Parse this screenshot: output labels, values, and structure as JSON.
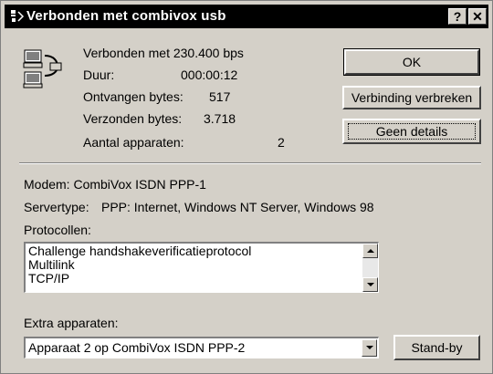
{
  "window": {
    "title": "Verbonden met combivox usb",
    "help_button": "?",
    "close_button": "✕"
  },
  "status": {
    "connected_at": "Verbonden met 230.400 bps",
    "duration_label": "Duur:",
    "duration_value": "000:00:12",
    "received_label": "Ontvangen bytes:",
    "received_value": "517",
    "sent_label": "Verzonden bytes:",
    "sent_value": "3.718",
    "devices_label": "Aantal apparaten:",
    "devices_value": "2"
  },
  "buttons": {
    "ok": "OK",
    "disconnect": "Verbinding verbreken",
    "less_details": "Geen details",
    "standby": "Stand-by"
  },
  "details": {
    "modem": "Modem: CombiVox ISDN PPP-1",
    "servertype_label": "Servertype:",
    "servertype_value": "PPP: Internet, Windows NT Server, Windows 98",
    "protocols_label": "Protocollen:",
    "protocols": [
      "Challenge handshakeverificatieprotocol",
      "Multilink",
      "TCP/IP"
    ],
    "extra_label": "Extra apparaten:",
    "extra_selected": "Apparaat 2 op CombiVox ISDN PPP-2"
  }
}
